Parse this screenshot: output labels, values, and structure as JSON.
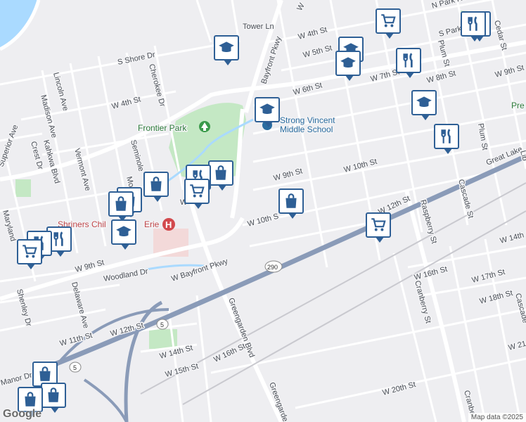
{
  "map": {
    "water_color": "#aadaff",
    "road_color": "#ffffff",
    "highway_color": "#8a9bb8",
    "park_color": "#c4e8c4",
    "pin_color": "#2e5f95"
  },
  "labels": {
    "tower_ln": "Tower Ln",
    "w_4th_st_top": "W 4th St",
    "w_5th_st": "W 5th St",
    "w_6th_st": "W 6th St",
    "w_7th_st": "W 7th St",
    "w_8th_st": "W 8th St",
    "w_9th_st_right": "W 9th St",
    "w_9th_st": "W 9th St",
    "w_10th_st": "W 10th St",
    "w_10th_st_left": "W 10th S",
    "w_12th_st": "W 12th St",
    "w_12th_st_left": "W 12th St",
    "w_11th_st": "W 11th St",
    "w_14th_st": "W 14th St",
    "w_15th_st": "W 15th St",
    "w_16th_st": "W 16th St",
    "w_16th_st_right": "W 16th St",
    "w_17th_st": "W 17th St",
    "w_18th_st": "W 18th St",
    "w_20th_st": "W 20th St",
    "w_4th_st_left": "W 4th St",
    "w_9th_st_left": "W 9th St",
    "w_14th_st_right": "W 14th St",
    "w_21st": "W 21s",
    "s_shore_dr": "S Shore Dr",
    "cherokee_dr": "Cherokee Dr",
    "lincoln_ave": "Lincoln Ave",
    "madison_ave": "Madison Ave",
    "kahkwa_blvd": "Kahkwa Blvd",
    "vermont_ave": "Vermont Ave",
    "superior_ave": "Superior Ave",
    "crest_dr": "Crest Dr",
    "maryland": "Maryland",
    "shenley_dr": "Shenley Dr",
    "delaware_ave": "Delaware Ave",
    "woodland_dr": "Woodland Dr",
    "manor_dr": "Manor Dr",
    "seminole": "Seminole",
    "mo": "Mo",
    "w_bayfront_pkwy": "W Bayfront Pkwy",
    "bayfront_pkwy": "Bayfront Pkwy",
    "greengarden_blvd": "Greengarden Blvd",
    "greengarden": "Greengarde",
    "raspberry_st": "Raspberry St",
    "cranberry_st": "Cranberry St",
    "cascade_st": "Cascade St",
    "cascade_right": "Cascade",
    "plum_st": "Plum St",
    "plum_st_top": "Plum St",
    "cedar_st": "Cedar St",
    "s_park_row": "S Park Row",
    "n_park_row": "N Park Ro",
    "great_lakes": "Great Lake",
    "liberty": "Lib",
    "cranber_bottom": "Cranber",
    "w_top": "W",
    "pre_right": "Pre",
    "frontier_park": "Frontier Park",
    "strong_vincent_1": "Strong Vincent",
    "strong_vincent_2": "Middle School",
    "shriners": "Shriners Chil",
    "shriners_erie": "Erie",
    "route_290": "290",
    "route_5a": "5",
    "route_5b": "5",
    "w_left": "W"
  },
  "footer": {
    "logo": "Google",
    "map_data": "Map data ©2025"
  }
}
